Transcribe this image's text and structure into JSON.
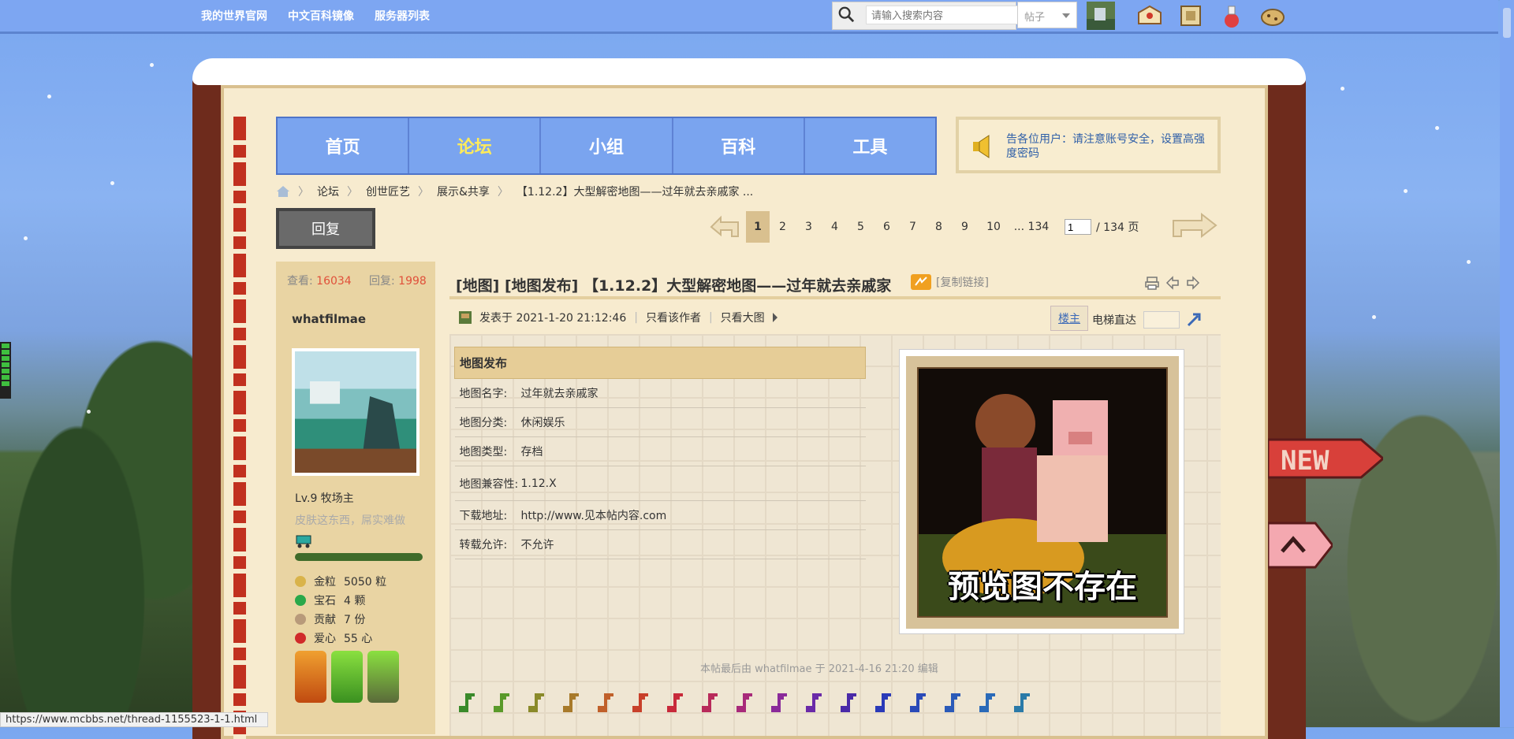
{
  "topbar": {
    "links": [
      "我的世界官网",
      "中文百科镜像",
      "服务器列表"
    ],
    "search_placeholder": "请输入搜索内容",
    "search_type": "帖子"
  },
  "nav": {
    "tabs": [
      "首页",
      "论坛",
      "小组",
      "百科",
      "工具"
    ],
    "active_tab": "论坛"
  },
  "notice": {
    "text": "告各位用户：请注意账号安全，设置高强度密码"
  },
  "breadcrumb": [
    "论坛",
    "创世匠艺",
    "展示&共享",
    "【1.12.2】大型解密地图——过年就去亲戚家 ..."
  ],
  "reply_label": "回复",
  "pagination": {
    "current": "1",
    "pages": [
      "2",
      "3",
      "4",
      "5",
      "6",
      "7",
      "8",
      "9",
      "10"
    ],
    "last": "... 134",
    "jump_value": "1",
    "total": "/ 134 页"
  },
  "sidebar": {
    "views_label": "查看:",
    "views": "16034",
    "replies_label": "回复:",
    "replies": "1998",
    "username": "whatfilmae",
    "level": "Lv.9 牧场主",
    "signature": "皮肤这东西，屌实难做",
    "progress_fraction": 1.0,
    "resources": [
      {
        "name": "金粒",
        "value": "5050 粒",
        "icon": "gold-nugget-icon",
        "color": "#d9b34a"
      },
      {
        "name": "宝石",
        "value": "4 颗",
        "icon": "emerald-icon",
        "color": "#2aa84a"
      },
      {
        "name": "贡献",
        "value": "7 份",
        "icon": "contribution-icon",
        "color": "#b89a7a"
      },
      {
        "name": "爱心",
        "value": "55 心",
        "icon": "apple-icon",
        "color": "#d02a2a"
      }
    ]
  },
  "post": {
    "title": "[地图] [地图发布] 【1.12.2】大型解密地图——过年就去亲戚家",
    "copy_link": "[复制链接]",
    "posted_label": "发表于 2021-1-20 21:12:46",
    "only_author": "只看该作者",
    "only_big_image": "只看大图",
    "louzhu": "楼主",
    "elevator": "电梯直达",
    "map_table": {
      "header": "地图发布",
      "rows": [
        {
          "label": "地图名字:",
          "value": "过年就去亲戚家"
        },
        {
          "label": "地图分类:",
          "value": "休闲娱乐"
        },
        {
          "label": "地图类型:",
          "value": "存档"
        },
        {
          "label": "地图兼容性:",
          "value": "1.12.X"
        },
        {
          "label": "下载地址:",
          "value": "http://www.见本帖内容.com"
        },
        {
          "label": "转载允许:",
          "value": "不允许"
        }
      ]
    },
    "preview_text": "预览图不存在",
    "edited": "本帖最后由 whatfilmae 于 2021-4-16 21:20 编辑",
    "note_colors": [
      "#3a8a2a",
      "#5a9a2a",
      "#8a8a2a",
      "#a87a2a",
      "#c0602a",
      "#c8402a",
      "#c82a3a",
      "#b82a5a",
      "#a82a7a",
      "#8a2a9a",
      "#6a2aa8",
      "#4a2aa8",
      "#2a3ab8",
      "#2a4ab8",
      "#2a5ab8",
      "#2a6ab8",
      "#2a7aa8"
    ]
  },
  "status_url": "https://www.mcbbs.net/thread-1155523-1-1.html"
}
